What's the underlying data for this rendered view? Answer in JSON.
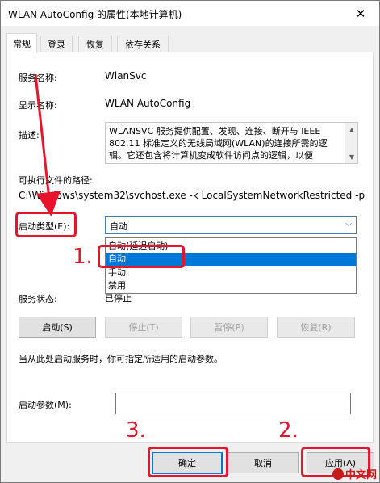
{
  "window": {
    "title": "WLAN AutoConfig 的属性(本地计算机)",
    "close_glyph": "✕"
  },
  "tabs": [
    {
      "label": "常规",
      "active": true
    },
    {
      "label": "登录",
      "active": false
    },
    {
      "label": "恢复",
      "active": false
    },
    {
      "label": "依存关系",
      "active": false
    }
  ],
  "general": {
    "service_name_label": "服务名称:",
    "service_name_value": "WlanSvc",
    "display_name_label": "显示名称:",
    "display_name_value": "WLAN AutoConfig",
    "description_label": "描述:",
    "description_value": "WLANSVC 服务提供配置、发现、连接、断开与 IEEE 802.11 标准定义的无线局域网(WLAN)的连接所需的逻辑。它还包含将计算机变成软件访问点的逻辑，以便",
    "exe_path_label": "可执行文件的路径:",
    "exe_path_value": "C:\\Windows\\system32\\svchost.exe -k LocalSystemNetworkRestricted -p",
    "startup_type_label": "启动类型(E):",
    "startup_type_selected": "自动",
    "startup_options": [
      "自动(延迟启动)",
      "自动",
      "手动",
      "禁用"
    ],
    "status_label": "服务状态:",
    "status_value": "已停止",
    "start_button": "启动(S)",
    "stop_button": "停止(T)",
    "pause_button": "暂停(P)",
    "resume_button": "恢复(R)",
    "hint_text": "当从此处启动服务时，你可指定所适用的启动参数。",
    "params_label": "启动参数(M):",
    "params_value": ""
  },
  "footer": {
    "ok": "确定",
    "cancel": "取消",
    "apply": "应用(A)"
  },
  "annotations": {
    "step1": "1.",
    "step2": "2.",
    "step3": "3.",
    "highlight_color": "#e8142b"
  },
  "watermark": "中文网",
  "colors": {
    "accent": "#0078d7",
    "annotation": "#e8142b"
  }
}
